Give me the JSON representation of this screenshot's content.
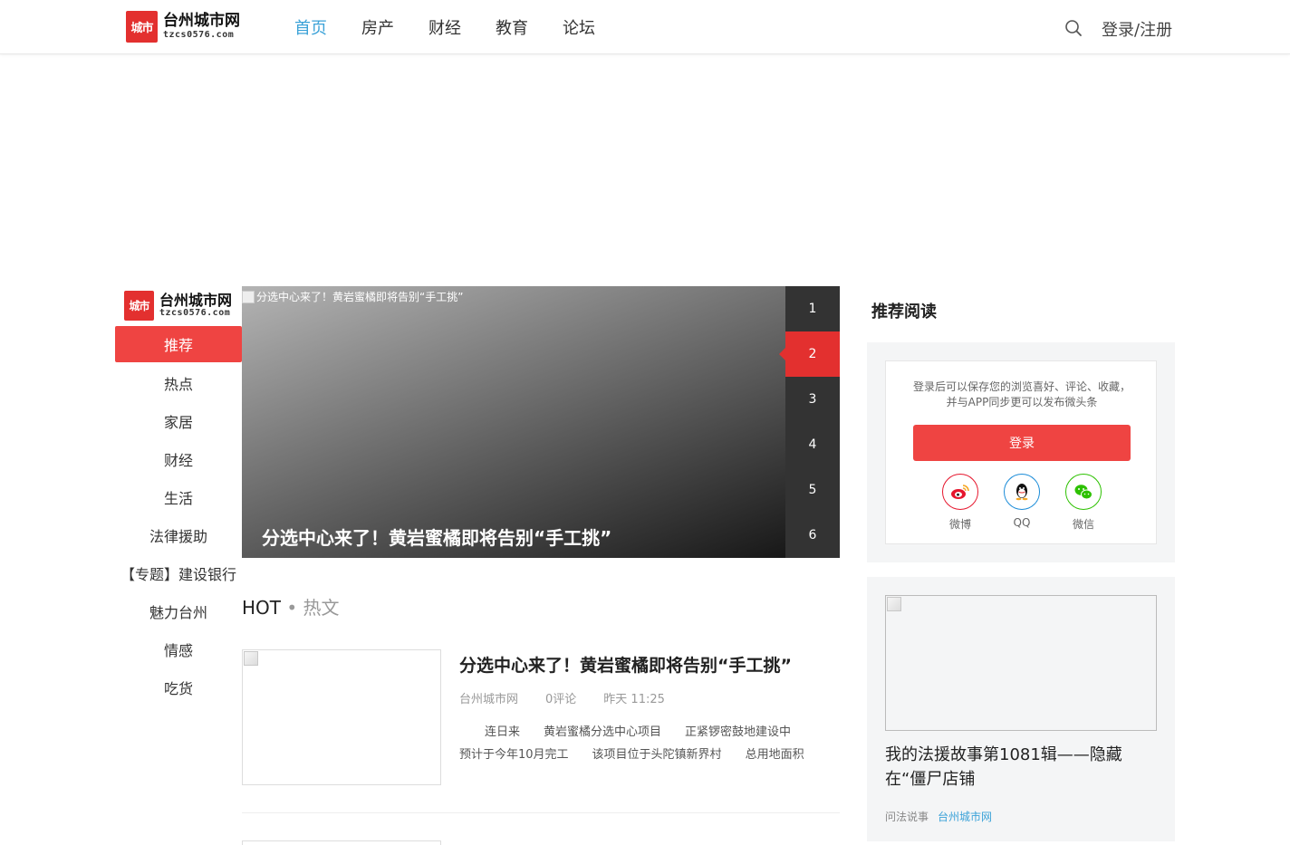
{
  "header": {
    "logo": {
      "badge": "城市",
      "name": "台州城市网",
      "domain": "tzcs0576.com"
    },
    "nav": [
      "首页",
      "房产",
      "财经",
      "教育",
      "论坛"
    ],
    "active_nav": "首页",
    "search_icon": "search-icon",
    "login": "登录/注册"
  },
  "sidebar": {
    "logo": {
      "badge": "城市",
      "name": "台州城市网",
      "domain": "tzcs0576.com"
    },
    "items": [
      "推荐",
      "热点",
      "家居",
      "财经",
      "生活",
      "法律援助",
      "【专题】建设银行",
      "魅力台州",
      "情感",
      "吃货"
    ],
    "active": "推荐"
  },
  "carousel": {
    "image_alt": "分选中心来了！黄岩蜜橘即将告别“手工挑”",
    "title": "分选中心来了！黄岩蜜橘即将告别“手工挑”",
    "pages": [
      "1",
      "2",
      "3",
      "4",
      "5",
      "6"
    ],
    "active_page": "2"
  },
  "hot": {
    "en": "HOT",
    "dot": "•",
    "cn": "热文"
  },
  "article": {
    "title": "分选中心来了！黄岩蜜橘即将告别“手工挑”",
    "source": "台州城市网",
    "comments": "0评论",
    "time": "昨天 11:25",
    "summary": [
      "连日来",
      "黄岩蜜橘分选中心项目",
      "正紧锣密鼓地建设中",
      "预计于今年10月完工",
      "该项目位于头陀镇新界村",
      "总用地面积"
    ]
  },
  "right": {
    "title": "推荐阅读",
    "login_desc_1": "登录后可以保存您的浏览喜好、评论、收藏，",
    "login_desc_2": "并与APP同步更可以发布微头条",
    "login_button": "登录",
    "socials": [
      {
        "label": "微博",
        "icon": "weibo-icon",
        "color": "#e6162d"
      },
      {
        "label": "QQ",
        "icon": "qq-icon",
        "color": "#1b8cd8"
      },
      {
        "label": "微信",
        "icon": "wechat-icon",
        "color": "#2dc100"
      }
    ],
    "card": {
      "title": "我的法援故事第1081辑——隐藏在“僵尸店铺",
      "category": "问法说事",
      "source": "台州城市网"
    }
  },
  "colors": {
    "accent_red": "#ef4442",
    "nav_active": "#3ba2d8"
  }
}
